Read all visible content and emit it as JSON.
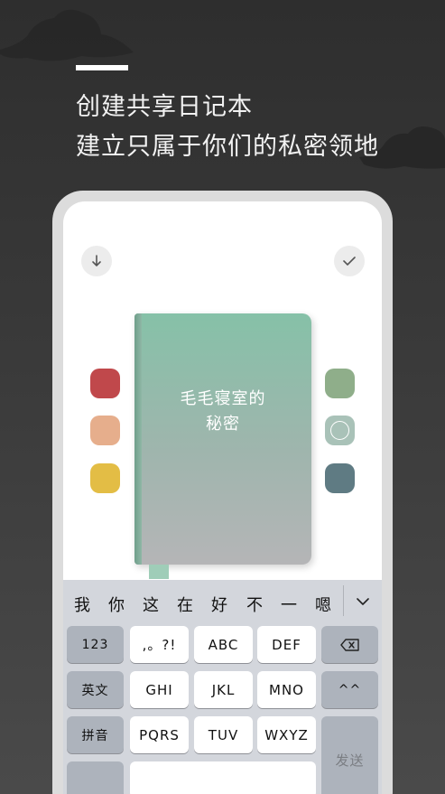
{
  "colors": {
    "background": "#333333",
    "swatches_left": [
      "#c0484b",
      "#e6ae8c",
      "#e3bd45"
    ],
    "swatches_right": [
      "#8fae8a",
      "#a9c2b8",
      "#5f7b83"
    ],
    "selected_swatch_index_right": 1
  },
  "headline": {
    "line1": "创建共享日记本",
    "line2": "建立只属于你们的私密领地"
  },
  "notebook": {
    "title_line1": "毛毛寝室的",
    "title_line2": "秘密"
  },
  "toolbar": {
    "back_icon": "down-arrow-icon",
    "confirm_icon": "check-icon"
  },
  "keyboard": {
    "candidates": [
      "我",
      "你",
      "这",
      "在",
      "好",
      "不",
      "一",
      "嗯"
    ],
    "collapse_icon": "chevron-down-icon",
    "row1": [
      "123",
      ",。?!",
      "ABC",
      "DEF"
    ],
    "row2": [
      "英文",
      "GHI",
      "JKL",
      "MNO",
      "^^"
    ],
    "row3": [
      "拼音",
      "PQRS",
      "TUV",
      "WXYZ"
    ],
    "delete_icon": "backspace-icon",
    "send_label": "发送"
  }
}
